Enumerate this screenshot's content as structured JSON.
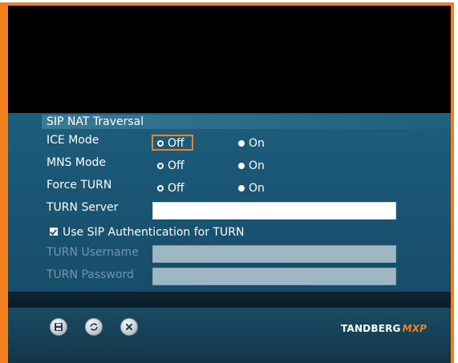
{
  "section": {
    "title": "SIP NAT Traversal"
  },
  "ice_mode": {
    "label": "ICE Mode",
    "off": "Off",
    "on": "On",
    "selected": "Off"
  },
  "mns_mode": {
    "label": "MNS Mode",
    "off": "Off",
    "on": "On",
    "selected": "Off"
  },
  "force_turn": {
    "label": "Force TURN",
    "off": "Off",
    "on": "On",
    "selected": "Off"
  },
  "turn_server": {
    "label": "TURN Server",
    "value": ""
  },
  "use_sip_auth": {
    "label": "Use SIP Authentication for TURN",
    "checked": true
  },
  "turn_username": {
    "label": "TURN Username",
    "value": ""
  },
  "turn_password": {
    "label": "TURN Password",
    "value": ""
  },
  "toolbar": {
    "save_icon": "save-icon",
    "refresh_icon": "refresh-icon",
    "close_icon": "close-icon"
  },
  "brand": {
    "name": "TANDBERG",
    "suffix": "MXP"
  },
  "colors": {
    "accent": "#f2801e",
    "panel": "#1d5d7c",
    "band": "#0b1d29",
    "bottom": "#163f55"
  }
}
